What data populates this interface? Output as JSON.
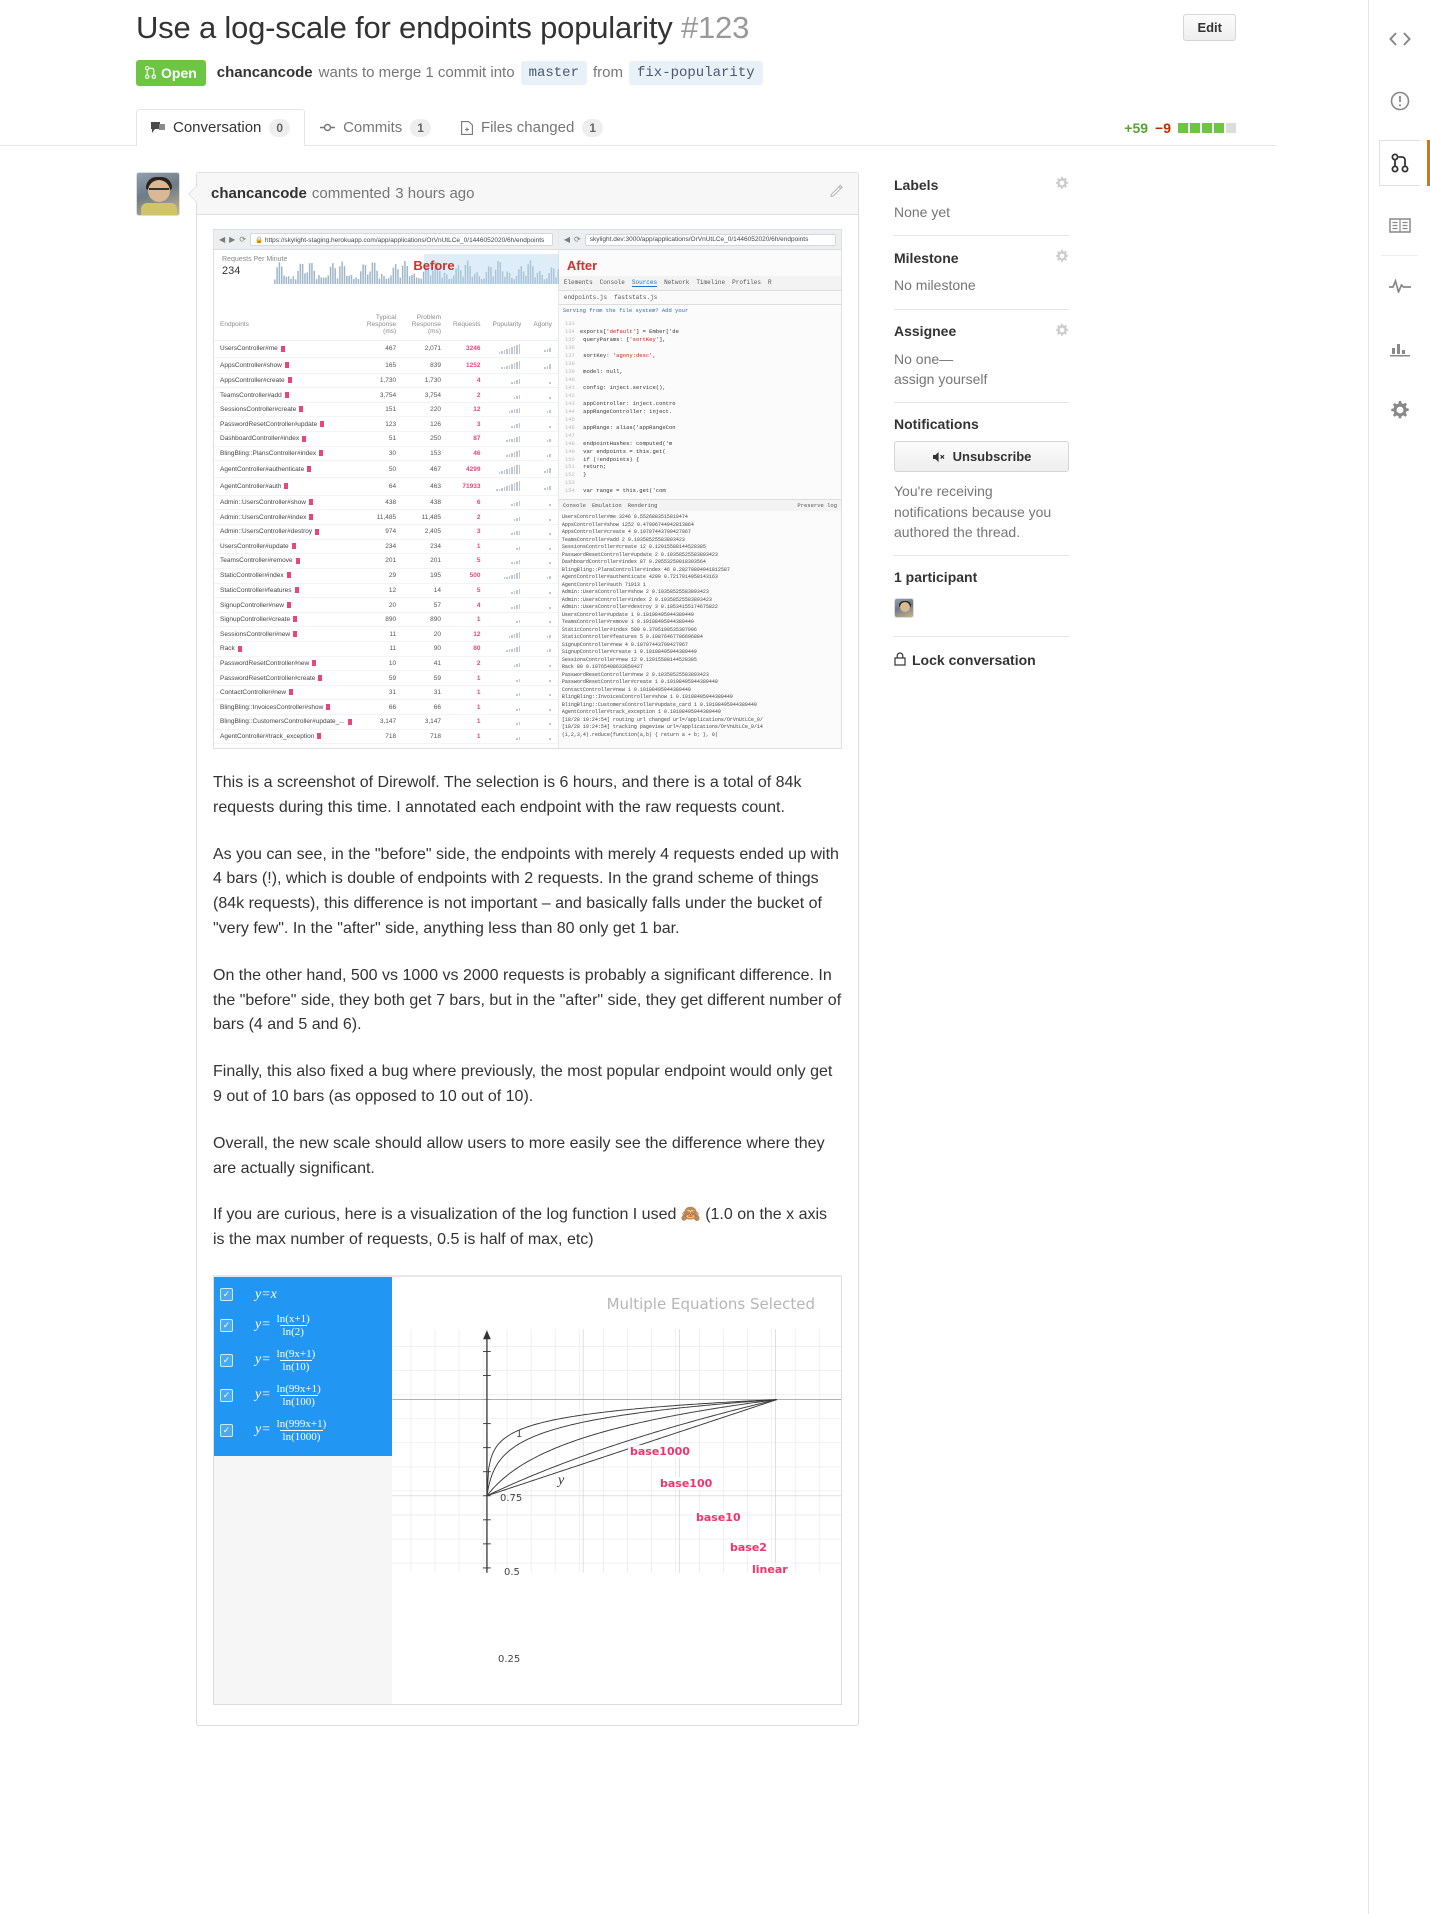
{
  "header": {
    "title": "Use a log-scale for endpoints popularity",
    "number": "#123",
    "edit_label": "Edit",
    "state": "Open",
    "author": "chancancode",
    "merge_text_1": "wants to merge 1 commit into",
    "base_branch": "master",
    "from_label": "from",
    "head_branch": "fix-popularity"
  },
  "tabs": [
    {
      "label": "Conversation",
      "count": "0",
      "icon": "comment-icon",
      "active": true
    },
    {
      "label": "Commits",
      "count": "1",
      "icon": "commit-icon",
      "active": false
    },
    {
      "label": "Files changed",
      "count": "1",
      "icon": "diff-icon",
      "active": false
    }
  ],
  "diffstat": {
    "additions": "+59",
    "deletions": "−9",
    "blocks": [
      "g",
      "g",
      "g",
      "g",
      "n"
    ],
    "add_color": "#55a532",
    "del_color": "#bd2c00",
    "block_color": "#6cc644"
  },
  "comment": {
    "author": "chancancode",
    "action": "commented",
    "time": "3 hours ago",
    "paragraphs": [
      "This is a screenshot of Direwolf. The selection is 6 hours, and there is a total of 84k requests during this time. I annotated each endpoint with the raw requests count.",
      "As you can see, in the \"before\" side, the endpoints with merely 4 requests ended up with 4 bars (!), which is double of endpoints with 2 requests. In the grand scheme of things (84k requests), this difference is not important – and basically falls under the bucket of \"very few\". In the \"after\" side, anything less than 80 only get 1 bar.",
      "On the other hand, 500 vs 1000 vs 2000 requests is probably a significant difference. In the \"before\" side, they both get 7 bars, but in the \"after\" side, they get different number of bars (4 and 5 and 6).",
      "Finally, this also fixed a bug where previously, the most popular endpoint would only get 9 out of 10 bars (as opposed to 10 out of 10).",
      "Overall, the new scale should allow users to more easily see the difference where they are actually significant.",
      "If you are curious, here is a visualization of the log function I used 🙈 (1.0 on the x axis is the max number of requests, 0.5 is half of max, etc)"
    ]
  },
  "screenshot": {
    "left_url": "https://skylight-staging.herokuapp.com/app/applications/OrVnUtLCe_0/1446052020/6h/endpoints",
    "right_url": "skylight.dev:3000/app/applications/OrVnUtLCe_0/1446052020/6h/endpoints",
    "rpm_label": "Requests Per Minute",
    "rpm_value": "234",
    "before_label": "Before",
    "after_label": "After",
    "columns": [
      "Endpoints",
      "Typical Response (ms)",
      "Problem Response (ms)",
      "Requests",
      "Popularity",
      "Agony"
    ],
    "rows": [
      {
        "name": "UsersController#me",
        "typical": "467",
        "problem": "2,071",
        "requests": "3246",
        "pop": 9
      },
      {
        "name": "AppsController#show",
        "typical": "165",
        "problem": "839",
        "requests": "1252",
        "pop": 8
      },
      {
        "name": "AppsController#create",
        "typical": "1,730",
        "problem": "1,730",
        "requests": "4",
        "pop": 4
      },
      {
        "name": "TeamsController#add",
        "typical": "3,754",
        "problem": "3,754",
        "requests": "2",
        "pop": 3
      },
      {
        "name": "SessionsController#create",
        "typical": "151",
        "problem": "220",
        "requests": "12",
        "pop": 5
      },
      {
        "name": "PasswordResetController#update",
        "typical": "123",
        "problem": "126",
        "requests": "3",
        "pop": 4
      },
      {
        "name": "DashboardController#index",
        "typical": "51",
        "problem": "250",
        "requests": "87",
        "pop": 6
      },
      {
        "name": "BlingBling::PlansController#index",
        "typical": "30",
        "problem": "153",
        "requests": "46",
        "pop": 6
      },
      {
        "name": "AgentController#authenticate",
        "typical": "50",
        "problem": "467",
        "requests": "4299",
        "pop": 9
      },
      {
        "name": "AgentController#auth",
        "typical": "64",
        "problem": "463",
        "requests": "71933",
        "pop": 10
      },
      {
        "name": "Admin::UsersController#show",
        "typical": "438",
        "problem": "438",
        "requests": "6",
        "pop": 4
      },
      {
        "name": "Admin::UsersController#index",
        "typical": "11,485",
        "problem": "11,485",
        "requests": "2",
        "pop": 3
      },
      {
        "name": "Admin::UsersController#destroy",
        "typical": "974",
        "problem": "2,405",
        "requests": "3",
        "pop": 4
      },
      {
        "name": "UsersController#update",
        "typical": "234",
        "problem": "234",
        "requests": "1",
        "pop": 2
      },
      {
        "name": "TeamsController#remove",
        "typical": "201",
        "problem": "201",
        "requests": "5",
        "pop": 4
      },
      {
        "name": "StaticController#index",
        "typical": "29",
        "problem": "195",
        "requests": "500",
        "pop": 7
      },
      {
        "name": "StaticController#features",
        "typical": "12",
        "problem": "14",
        "requests": "5",
        "pop": 4
      },
      {
        "name": "SignupController#new",
        "typical": "20",
        "problem": "57",
        "requests": "4",
        "pop": 4
      },
      {
        "name": "SignupController#create",
        "typical": "890",
        "problem": "890",
        "requests": "1",
        "pop": 2
      },
      {
        "name": "SessionsController#new",
        "typical": "11",
        "problem": "20",
        "requests": "12",
        "pop": 5
      },
      {
        "name": "Rack",
        "typical": "11",
        "problem": "90",
        "requests": "80",
        "pop": 6
      },
      {
        "name": "PasswordResetController#new",
        "typical": "10",
        "problem": "41",
        "requests": "2",
        "pop": 3
      },
      {
        "name": "PasswordResetController#create",
        "typical": "59",
        "problem": "59",
        "requests": "1",
        "pop": 2
      },
      {
        "name": "ContactController#new",
        "typical": "31",
        "problem": "31",
        "requests": "1",
        "pop": 2
      },
      {
        "name": "BlingBling::InvoicesController#show",
        "typical": "66",
        "problem": "66",
        "requests": "1",
        "pop": 2
      },
      {
        "name": "BlingBling::CustomersController#update_...",
        "typical": "3,147",
        "problem": "3,147",
        "requests": "1",
        "pop": 2
      },
      {
        "name": "AgentController#track_exception",
        "typical": "718",
        "problem": "718",
        "requests": "1",
        "pop": 2
      }
    ],
    "devtools_tabs": [
      "Elements",
      "Console",
      "Sources",
      "Network",
      "Timeline",
      "Profiles",
      "R"
    ],
    "devtools_files": [
      "endpoints.js",
      "faststats.js"
    ],
    "devtools_banner": "Serving from the file system? Add your",
    "code_lines": [
      {
        "n": "133",
        "t": ""
      },
      {
        "n": "134",
        "t": "exports['default'] = Ember['de"
      },
      {
        "n": "135",
        "t": "  queryParams: ['sortKey'],"
      },
      {
        "n": "136",
        "t": ""
      },
      {
        "n": "137",
        "t": "  sortKey: 'agony:desc',"
      },
      {
        "n": "138",
        "t": ""
      },
      {
        "n": "139",
        "t": "  model: null,"
      },
      {
        "n": "140",
        "t": ""
      },
      {
        "n": "141",
        "t": "  config: inject.service(),"
      },
      {
        "n": "142",
        "t": ""
      },
      {
        "n": "143",
        "t": "  appController: inject.contro"
      },
      {
        "n": "144",
        "t": "  appRangeController: inject."
      },
      {
        "n": "145",
        "t": ""
      },
      {
        "n": "146",
        "t": "  appRange: alias('appRangeCon"
      },
      {
        "n": "147",
        "t": ""
      },
      {
        "n": "148",
        "t": "  endpointHashes: computed('m"
      },
      {
        "n": "149",
        "t": "    var endpoints = this.get("
      },
      {
        "n": "150",
        "t": "    if (!endpoints) {"
      },
      {
        "n": "151",
        "t": "      return;"
      },
      {
        "n": "152",
        "t": "    }"
      },
      {
        "n": "153",
        "t": ""
      },
      {
        "n": "154",
        "t": "    var range = this.get('com"
      }
    ],
    "console_header": [
      "Console",
      "Emulation",
      "Rendering"
    ],
    "console_preserve": "Preserve log",
    "console_lines": [
      "UsersController#me 3246 0.5526883515819474",
      "AppsController#show 1252 0.47996744942813864",
      "AppsController#create 4 0.10707443709427967",
      "TeamsController#add 2 0.10358525583893423",
      "SessionsController#create 12 0.12015588144528385",
      "PasswordResetController#update 2 0.10358525583893423",
      "DashboardController#index 87 0.20553250018303564",
      "BlingBling::PlansController#index 46 0.20270894941812587",
      "AgentController#authenticate 4299 0.7217014958143163",
      "AgentController#auth 71913 1",
      "Admin::UsersController#show 2 0.10358525583893423",
      "Admin::UsersController#index 2 0.10358525583893423",
      "Admin::UsersController#destroy 3 0.10534155174675822",
      "UsersController#update 1 0.10108495944389449",
      "TeamsController#remove 1 0.10108495944389449",
      "StaticController#index 500 0.3705190535307996",
      "StaticController#features 5 0.10876467706696884",
      "SignupController#new 4 0.10707443709427967",
      "SignupController#create 1 0.10108495944389449",
      "SessionsController#new 12 0.12015588144528385",
      "Rack 80 0.19765408633850427",
      "PasswordResetController#new 2 0.10358525583893423",
      "PasswordResetController#create 1 0.10108495944389449",
      "ContactController#new 1 0.10108495944389449",
      "BlingBling::InvoicesController#show 1 0.10108495944389449",
      "BlingBling::CustomersController#update_card 1 0.10108495944389449",
      "AgentController#track_exception 1 0.10108495944389449",
      "[18/28 19:24:54] routing url changed url=/applications/OrVnUtLCe_0/",
      "[18/28 19:24:54] tracking pageview url=/applications/OrVnUtLCe_0/14",
      "(1,2,3,4).reduce(function(a,b) { return a + b; }, 0)"
    ]
  },
  "desmos": {
    "title": "Multiple Equations Selected",
    "equations": [
      {
        "lhs": "y=",
        "plain": "x",
        "num": "",
        "den": ""
      },
      {
        "lhs": "y=",
        "plain": "",
        "num": "ln(x+1)",
        "den": "ln(2)"
      },
      {
        "lhs": "y=",
        "plain": "",
        "num": "ln(9x+1)",
        "den": "ln(10)"
      },
      {
        "lhs": "y=",
        "plain": "",
        "num": "ln(99x+1)",
        "den": "ln(100)"
      },
      {
        "lhs": "y=",
        "plain": "",
        "num": "ln(999x+1)",
        "den": "ln(1000)"
      }
    ],
    "y_label": "y",
    "y_ticks": [
      "1",
      "0.75",
      "0.5",
      "0.25"
    ],
    "curve_labels": [
      "base1000",
      "base100",
      "base10",
      "base2",
      "linear"
    ],
    "label_color": "#f0336b"
  },
  "sidebar": {
    "labels": {
      "head": "Labels",
      "value": "None yet"
    },
    "milestone": {
      "head": "Milestone",
      "value": "No milestone"
    },
    "assignee": {
      "head": "Assignee",
      "value": "No one—\nassign yourself"
    },
    "notifications": {
      "head": "Notifications",
      "button": "Unsubscribe",
      "text": "You're receiving notifications because you authored the thread."
    },
    "participants": {
      "head": "1 participant"
    },
    "lock": {
      "label": "Lock conversation"
    }
  },
  "rail": [
    {
      "icon": "code-icon",
      "name": "rail-code",
      "sel": false
    },
    {
      "icon": "issue-icon",
      "name": "rail-issues",
      "sel": false
    },
    {
      "icon": "pull-request-icon",
      "name": "rail-pull-requests",
      "sel": true
    },
    {
      "icon": "book-icon",
      "name": "rail-wiki",
      "sel": false
    },
    {
      "icon": "pulse-icon",
      "name": "rail-pulse",
      "sel": false
    },
    {
      "icon": "graph-icon",
      "name": "rail-graphs",
      "sel": false
    },
    {
      "icon": "gear-icon",
      "name": "rail-settings",
      "sel": false
    }
  ]
}
